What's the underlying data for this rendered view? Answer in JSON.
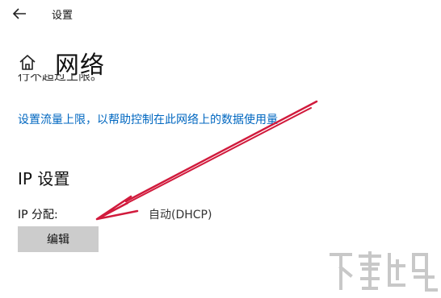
{
  "window": {
    "title": "设置"
  },
  "header": {
    "title": "网络"
  },
  "partial_text": "行不超过上限。",
  "metered": {
    "link_text": "设置流量上限，以帮助控制在此网络上的数据使用量"
  },
  "ip_settings": {
    "heading": "IP 设置",
    "assignment_label": "IP 分配:",
    "assignment_value": "自动(DHCP)",
    "edit_button": "编辑"
  },
  "colors": {
    "link": "#0067c0",
    "arrow": "#d11a3c",
    "button_bg": "#cccccc"
  },
  "icons": [
    "back-arrow-icon",
    "home-icon"
  ]
}
